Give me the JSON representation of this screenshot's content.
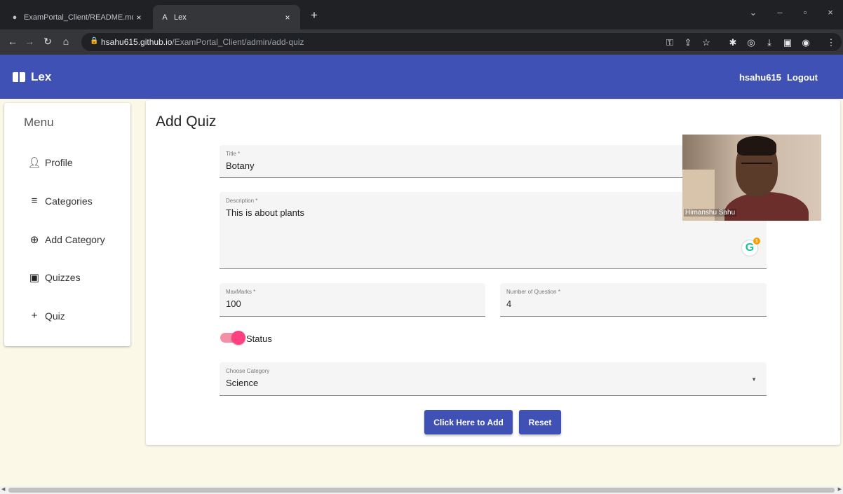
{
  "browser": {
    "tabs": [
      {
        "title": "ExamPortal_Client/README.md",
        "icon": "github-icon"
      },
      {
        "title": "Lex",
        "icon": "angular-icon"
      }
    ],
    "url_host": "hsahu615.github.io",
    "url_path": "/ExamPortal_Client/admin/add-quiz"
  },
  "app": {
    "brand": "Lex",
    "user": "hsahu615",
    "logout": "Logout",
    "accent_color": "#3f51b5"
  },
  "sidebar": {
    "title": "Menu",
    "items": [
      {
        "label": "Profile",
        "icon": "person-icon"
      },
      {
        "label": "Categories",
        "icon": "list-icon"
      },
      {
        "label": "Add Category",
        "icon": "add-circle-icon"
      },
      {
        "label": "Quizzes",
        "icon": "quiz-icon"
      },
      {
        "label": "Quiz",
        "icon": "plus-icon"
      }
    ]
  },
  "form": {
    "page_title": "Add Quiz",
    "title_label": "Title *",
    "title_value": "Botany",
    "description_label": "Description *",
    "description_value": "This is about plants",
    "maxmarks_label": "MaxMarks *",
    "maxmarks_value": "100",
    "questions_label": "Number of Question *",
    "questions_value": "4",
    "status_label": "Status",
    "status_on": true,
    "category_label": "Choose Category",
    "category_value": "Science",
    "add_button": "Click Here to Add",
    "reset_button": "Reset"
  },
  "video_overlay": {
    "name": "Himanshu Sahu"
  }
}
